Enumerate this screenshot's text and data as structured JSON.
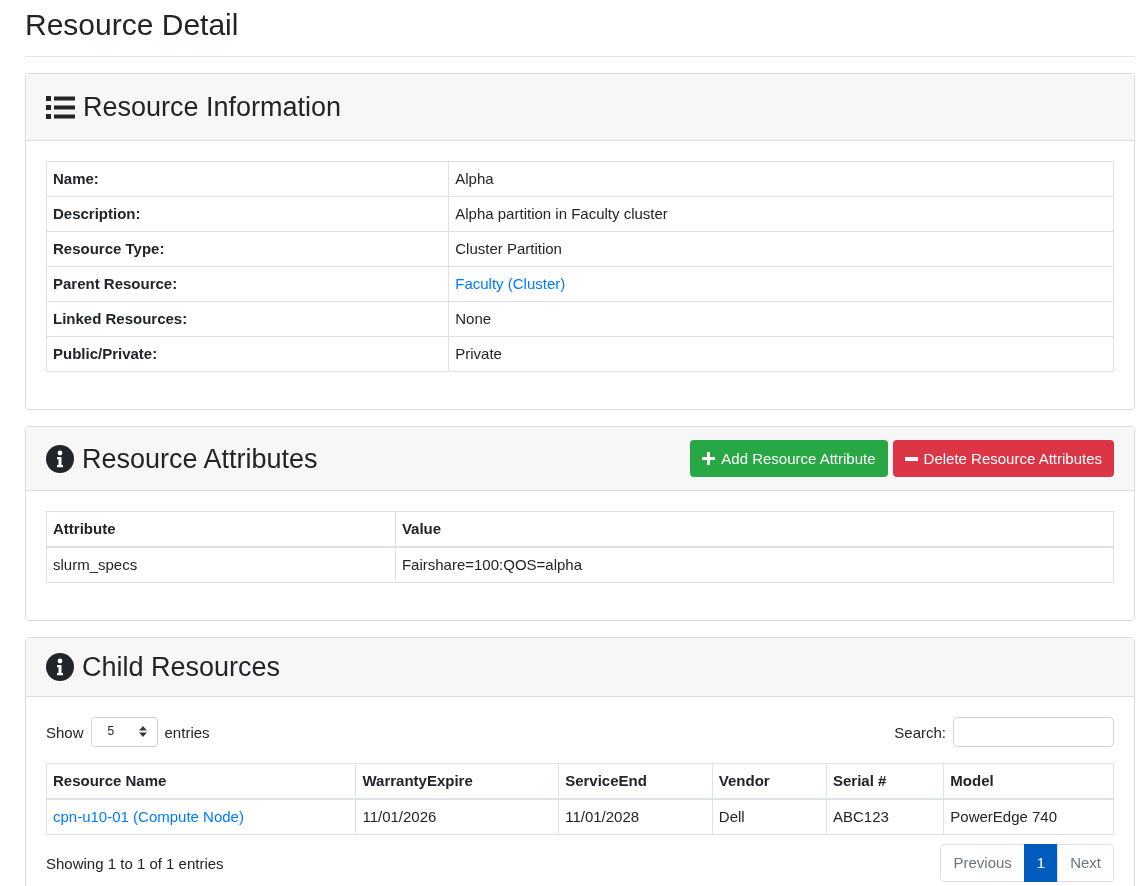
{
  "page": {
    "title": "Resource Detail"
  },
  "resource_information": {
    "title": "Resource Information",
    "rows": [
      {
        "label": "Name:",
        "value": "Alpha",
        "kind": "text"
      },
      {
        "label": "Description:",
        "value": "Alpha partition in Faculty cluster",
        "kind": "text"
      },
      {
        "label": "Resource Type:",
        "value": "Cluster Partition",
        "kind": "text"
      },
      {
        "label": "Parent Resource:",
        "value": "Faculty (Cluster)",
        "kind": "link"
      },
      {
        "label": "Linked Resources:",
        "value": "None",
        "kind": "text"
      },
      {
        "label": "Public/Private:",
        "value": "Private",
        "kind": "text"
      }
    ]
  },
  "resource_attributes": {
    "title": "Resource Attributes",
    "buttons": [
      {
        "label": "Add Resource Attribute",
        "kind": "add"
      },
      {
        "label": "Delete Resource Attributes",
        "kind": "delete"
      }
    ],
    "table": {
      "columns": [
        "Attribute",
        "Value"
      ],
      "rows": [
        {
          "cells": [
            {
              "text": "slurm_specs",
              "kind": "text"
            },
            {
              "text": "Fairshare=100:QOS=alpha",
              "kind": "text"
            }
          ]
        }
      ]
    }
  },
  "child_resources": {
    "title": "Child Resources",
    "length_menu": {
      "label_before": "Show",
      "value": "5",
      "label_after": "entries"
    },
    "search": {
      "label": "Search:"
    },
    "table": {
      "columns": [
        "Resource Name",
        "WarrantyExpire",
        "ServiceEnd",
        "Vendor",
        "Serial #",
        "Model"
      ],
      "rows": [
        {
          "cells": [
            {
              "text": "cpn-u10-01 (Compute Node)",
              "kind": "link"
            },
            {
              "text": "11/01/2026",
              "kind": "text"
            },
            {
              "text": "11/01/2028",
              "kind": "text"
            },
            {
              "text": "Dell",
              "kind": "text"
            },
            {
              "text": "ABC123",
              "kind": "text"
            },
            {
              "text": "PowerEdge 740",
              "kind": "text"
            }
          ]
        }
      ]
    },
    "info": "Showing 1 to 1 of 1 entries",
    "pagination": [
      {
        "label": "Previous",
        "selected": false,
        "disabled": true
      },
      {
        "label": "1",
        "selected": true,
        "disabled": false
      },
      {
        "label": "Next",
        "selected": false,
        "disabled": true
      }
    ]
  }
}
